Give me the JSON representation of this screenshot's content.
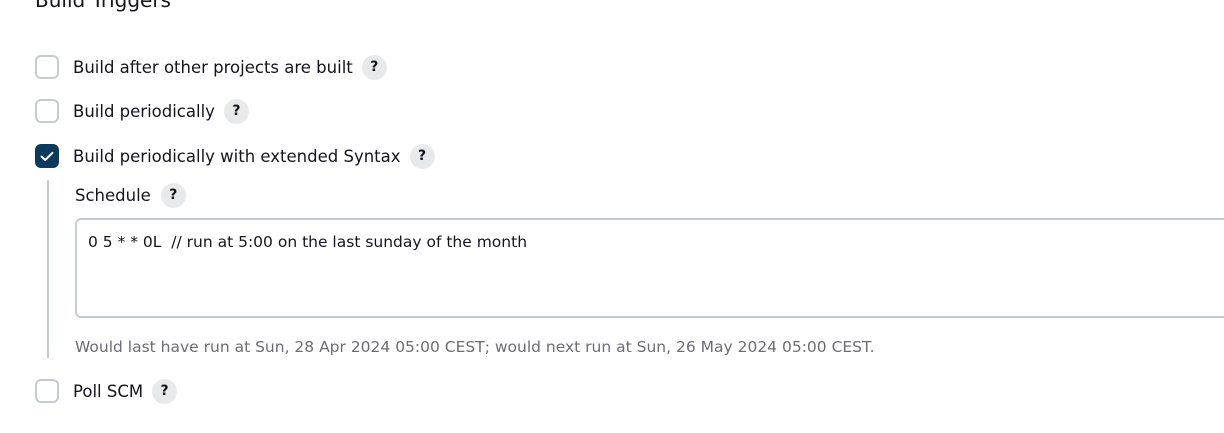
{
  "section": {
    "title": "Build Triggers"
  },
  "options": [
    {
      "label": "Build after other projects are built",
      "checked": false,
      "help": "?"
    },
    {
      "label": "Build periodically",
      "checked": false,
      "help": "?"
    },
    {
      "label": "Build periodically with extended Syntax",
      "checked": true,
      "help": "?"
    },
    {
      "label": "Poll SCM",
      "checked": false,
      "help": "?"
    }
  ],
  "schedule": {
    "label": "Schedule",
    "help": "?",
    "value": "0 5 * * 0L  // run at 5:00 on the last sunday of the month",
    "hint": "Would last have run at Sun, 28 Apr 2024 05:00 CEST; would next run at Sun, 26 May 2024 05:00 CEST."
  },
  "colors": {
    "checkbox_checked": "#0b3a5c",
    "checkbox_border": "#c6cbd1",
    "help_bg": "#e8e9eb",
    "hint_text": "#6c6c7a"
  }
}
